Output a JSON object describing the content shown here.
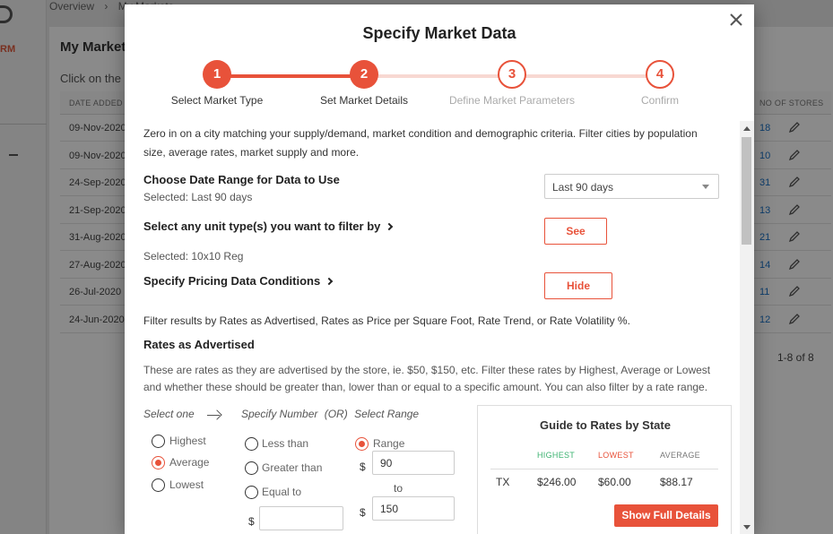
{
  "background": {
    "brand": "RM",
    "breadcrumb": {
      "overview": "Overview",
      "sep": "›",
      "current": "My Markets"
    },
    "title": "My Markets",
    "subtitle": "Click on the",
    "columns": {
      "date_added": "DATE ADDED",
      "no_of_stores": "NO OF STORES"
    },
    "rows": [
      {
        "date": "09-Nov-2020",
        "stores": "18"
      },
      {
        "date": "09-Nov-2020",
        "stores": "10"
      },
      {
        "date": "24-Sep-2020",
        "stores": "31"
      },
      {
        "date": "21-Sep-2020",
        "stores": "13"
      },
      {
        "date": "31-Aug-2020",
        "stores": "21"
      },
      {
        "date": "27-Aug-2020",
        "stores": "14"
      },
      {
        "date": "26-Jul-2020",
        "stores": "11"
      },
      {
        "date": "24-Jun-2020",
        "stores": "12"
      }
    ],
    "pager": "1-8 of 8"
  },
  "modal": {
    "title": "Specify Market Data",
    "close_icon": "close-icon",
    "steps": [
      {
        "number": "1",
        "label": "Select Market Type",
        "state": "done"
      },
      {
        "number": "2",
        "label": "Set Market Details",
        "state": "current"
      },
      {
        "number": "3",
        "label": "Define Market Parameters",
        "state": "todo"
      },
      {
        "number": "4",
        "label": "Confirm",
        "state": "todo"
      }
    ],
    "intro": "Zero in on a city matching your supply/demand, market condition and demographic criteria. Filter cities by population size, average rates, market supply and more.",
    "date_range": {
      "heading": "Choose Date Range for Data to Use",
      "selected": "Selected: Last 90 days",
      "value": "Last 90 days"
    },
    "unit_types": {
      "heading": "Select any unit type(s) you want to filter by",
      "button": "See",
      "selected": "Selected: 10x10 Reg"
    },
    "pricing": {
      "heading": "Specify Pricing Data Conditions",
      "button": "Hide"
    },
    "filter_line": "Filter results by Rates as Advertised, Rates as Price per Square Foot, Rate Trend, or Rate Volatility %.",
    "rates": {
      "heading": "Rates as Advertised",
      "description": "These are rates as they are advertised by the store, ie. $50, $150, etc. Filter these rates by Highest, Average or Lowest and whether these should be greater than, lower than or equal to a specific amount. You can also filter by a rate range.",
      "select_one": "Select one",
      "specify_number": "Specify Number",
      "or": "(OR)",
      "select_range": "Select Range",
      "options": {
        "highest": "Highest",
        "average": "Average",
        "lowest": "Lowest"
      },
      "selected_option": "Average",
      "comparisons": {
        "less_than": "Less than",
        "greater_than": "Greater than",
        "equal_to": "Equal to",
        "range": "Range"
      },
      "selected_comparison": "Range",
      "currency": "$",
      "amount": "",
      "range_from": "90",
      "range_to_label": "to",
      "range_to": "150"
    },
    "guide": {
      "title": "Guide to Rates by State",
      "headers": {
        "highest": "HIGHEST",
        "lowest": "LOWEST",
        "average": "AVERAGE"
      },
      "row": {
        "state": "TX",
        "highest": "$246.00",
        "lowest": "$60.00",
        "average": "$88.17"
      },
      "button": "Show Full Details"
    }
  },
  "colors": {
    "accent": "#e8523a",
    "highest": "#3cb371",
    "lowest": "#e8523a"
  }
}
